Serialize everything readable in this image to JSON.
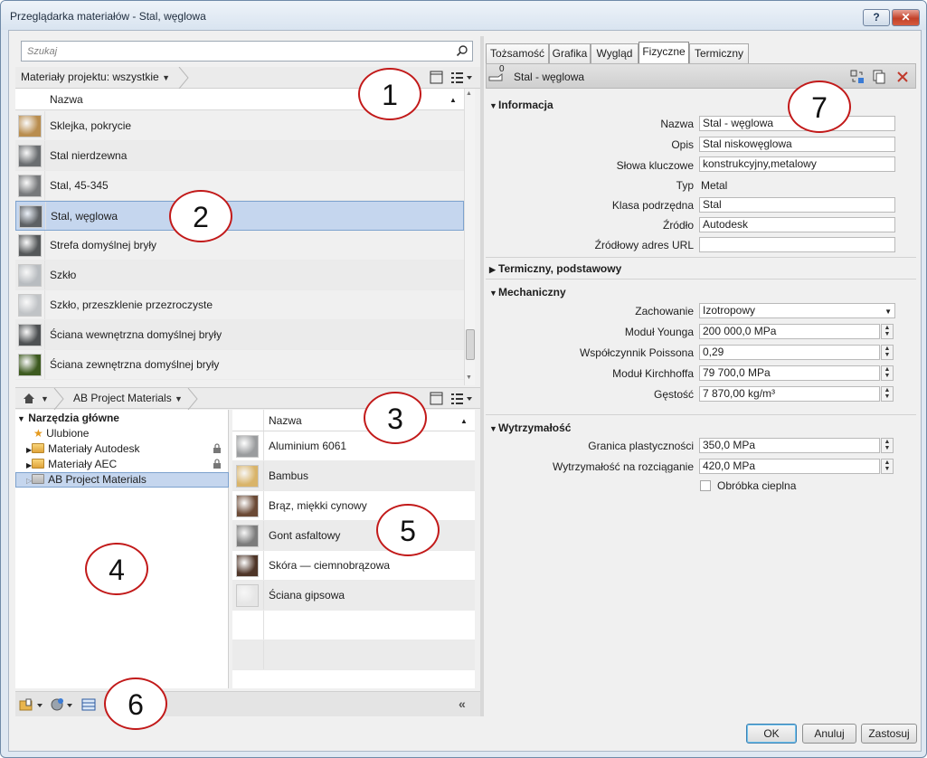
{
  "window": {
    "title": "Przeglądarka materiałów - Stal, węglowa",
    "help_label": "?",
    "close_label": "✕"
  },
  "search": {
    "placeholder": "Szukaj"
  },
  "project_breadcrumb": {
    "label": "Materiały projektu: wszystkie"
  },
  "project_list": {
    "column_header": "Nazwa",
    "items": [
      {
        "name": "Sklejka, pokrycie",
        "thumb": "#b98d4e"
      },
      {
        "name": "Stal nierdzewna",
        "thumb": "#6a6d70"
      },
      {
        "name": "Stal, 45-345",
        "thumb": "#77797b"
      },
      {
        "name": "Stal, węglowa",
        "thumb": "#5d6063",
        "selected": true
      },
      {
        "name": "Strefa domyślnej bryły",
        "thumb": "#55585a"
      },
      {
        "name": "Szkło",
        "thumb": "#b8bcc0"
      },
      {
        "name": "Szkło, przeszklenie przezroczyste",
        "thumb": "#c0c3c6"
      },
      {
        "name": "Ściana wewnętrzna domyślnej bryły",
        "thumb": "#4d5052"
      },
      {
        "name": "Ściana zewnętrzna domyślnej bryły",
        "thumb": "#3d5a1f"
      }
    ]
  },
  "library_breadcrumb": {
    "label": "AB Project Materials"
  },
  "tree": {
    "root": "Narzędzia główne",
    "items": [
      {
        "label": "Ulubione",
        "icon": "star-icon"
      },
      {
        "label": "Materiały Autodesk",
        "icon": "folder-icon",
        "locked": true
      },
      {
        "label": "Materiały AEC",
        "icon": "folder-icon",
        "locked": true
      },
      {
        "label": "AB Project Materials",
        "icon": "folder-icon",
        "selected": true
      }
    ]
  },
  "library_list": {
    "column_header": "Nazwa",
    "items": [
      {
        "name": "Aluminium 6061",
        "thumb": "#9a9c9e"
      },
      {
        "name": "Bambus",
        "thumb": "#d9b46a"
      },
      {
        "name": "Brąz, miękki cynowy",
        "thumb": "#6b4a36"
      },
      {
        "name": "Gont asfaltowy",
        "thumb": "#7c7c7c"
      },
      {
        "name": "Skóra — ciemnobrązowa",
        "thumb": "#4e3528"
      },
      {
        "name": "Ściana gipsowa",
        "thumb": "#e6e6e6"
      }
    ]
  },
  "tabs": [
    "Tożsamość",
    "Grafika",
    "Wygląd",
    "Fizyczne",
    "Termiczny"
  ],
  "active_tab": "Fizyczne",
  "material_header": {
    "name": "Stal - węglowa",
    "usage_count": "0"
  },
  "info": {
    "title": "Informacja",
    "name_label": "Nazwa",
    "name_value": "Stal - węglowa",
    "desc_label": "Opis",
    "desc_value": "Stal niskowęglowa",
    "keywords_label": "Słowa kluczowe",
    "keywords_value": "konstrukcyjny,metalowy",
    "type_label": "Typ",
    "type_value": "Metal",
    "subclass_label": "Klasa podrzędna",
    "subclass_value": "Stal",
    "source_label": "Źródło",
    "source_value": "Autodesk",
    "url_label": "Źródłowy adres URL",
    "url_value": ""
  },
  "thermal_basic": {
    "title": "Termiczny, podstawowy"
  },
  "mechanical": {
    "title": "Mechaniczny",
    "behavior_label": "Zachowanie",
    "behavior_value": "Izotropowy",
    "young_label": "Moduł Younga",
    "young_value": "200 000,0 MPa",
    "poisson_label": "Współczynnik Poissona",
    "poisson_value": "0,29",
    "shear_label": "Moduł Kirchhoffa",
    "shear_value": "79 700,0 MPa",
    "density_label": "Gęstość",
    "density_value": "7 870,00 kg/m³"
  },
  "strength": {
    "title": "Wytrzymałość",
    "yield_label": "Granica plastyczności",
    "yield_value": "350,0 MPa",
    "tensile_label": "Wytrzymałość na rozciąganie",
    "tensile_value": "420,0 MPa",
    "heat_label": "Obróbka cieplna"
  },
  "buttons": {
    "ok": "OK",
    "cancel": "Anuluj",
    "apply": "Zastosuj"
  },
  "callouts": [
    "1",
    "2",
    "3",
    "4",
    "5",
    "6",
    "7"
  ],
  "colors": {
    "selection": "#c5d6ee",
    "close_red": "#c24129",
    "callout_red": "#c21a1a"
  }
}
